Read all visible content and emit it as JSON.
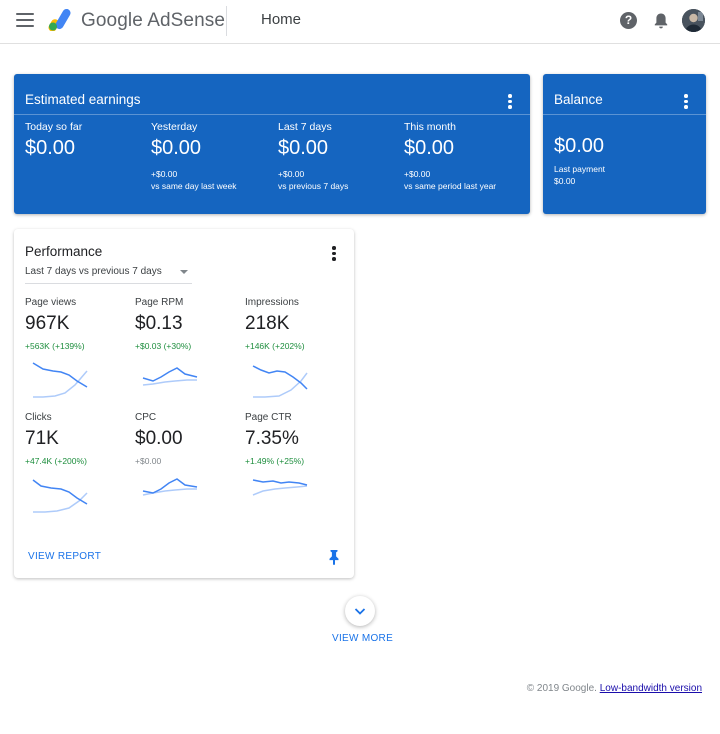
{
  "header": {
    "brand": "Google AdSense",
    "page_title": "Home",
    "help_glyph": "?",
    "icons": [
      "menu-icon",
      "adsense-logo",
      "help-icon",
      "bell-icon",
      "avatar"
    ]
  },
  "colors": {
    "card_blue": "#1565c0",
    "positive_green": "#1e8e3e",
    "link_blue": "#1a73e8",
    "sparkline_current": "#4285f4",
    "sparkline_previous": "#aecbfa"
  },
  "earnings": {
    "title": "Estimated earnings",
    "columns": [
      {
        "label": "Today so far",
        "value": "$0.00",
        "delta": "",
        "compare": ""
      },
      {
        "label": "Yesterday",
        "value": "$0.00",
        "delta": "+$0.00",
        "compare": "vs same day last week"
      },
      {
        "label": "Last 7 days",
        "value": "$0.00",
        "delta": "+$0.00",
        "compare": "vs previous 7 days"
      },
      {
        "label": "This month",
        "value": "$0.00",
        "delta": "+$0.00",
        "compare": "vs same period last year"
      }
    ]
  },
  "balance": {
    "title": "Balance",
    "value": "$0.00",
    "last_payment_label": "Last payment",
    "last_payment_value": "$0.00"
  },
  "performance": {
    "title": "Performance",
    "range": "Last 7 days vs previous 7 days",
    "view_report": "VIEW REPORT",
    "metrics": [
      {
        "label": "Page views",
        "value": "967K",
        "delta": "+563K (+139%)"
      },
      {
        "label": "Page RPM",
        "value": "$0.13",
        "delta": "+$0.03 (+30%)"
      },
      {
        "label": "Impressions",
        "value": "218K",
        "delta": "+146K (+202%)"
      },
      {
        "label": "Clicks",
        "value": "71K",
        "delta": "+47.4K (+200%)"
      },
      {
        "label": "CPC",
        "value": "$0.00",
        "delta": "+$0.00"
      },
      {
        "label": "Page CTR",
        "value": "7.35%",
        "delta": "+1.49% (+25%)"
      }
    ]
  },
  "view_more": "VIEW MORE",
  "footer": {
    "copyright": "© 2019 Google.",
    "link": "Low-bandwidth version"
  }
}
